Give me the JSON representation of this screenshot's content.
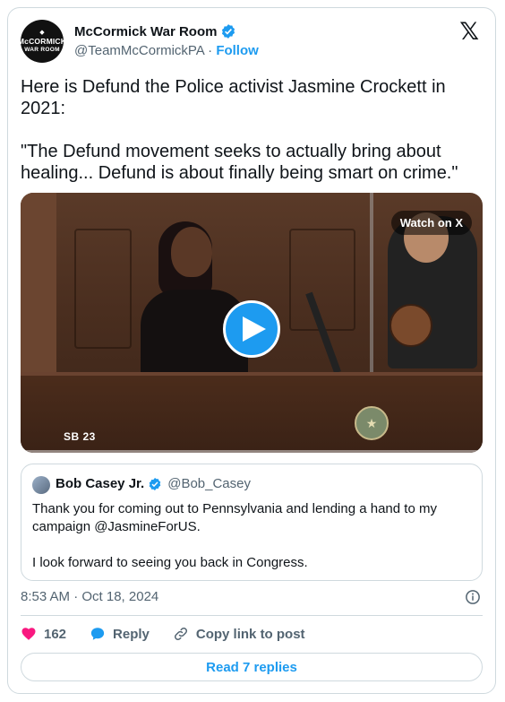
{
  "author": {
    "name": "McCormick War Room",
    "handle": "@TeamMcCormickPA",
    "separator": " · ",
    "follow_label": "Follow",
    "avatar_line1": "McCORMICK",
    "avatar_line2": "WAR ROOM",
    "verified_icon": "verified-badge-icon",
    "verified_color": "#1d9bf0"
  },
  "platform_icon": "x-logo-icon",
  "tweet": {
    "paragraph1": "Here is Defund the Police activist Jasmine Crockett in 2021:",
    "paragraph2": "\"The Defund movement seeks to actually bring about healing... Defund is about finally being smart on crime.\""
  },
  "media": {
    "watch_label": "Watch on X",
    "caption": "SB  23",
    "play_icon": "play-icon",
    "play_color": "#1d9bf0"
  },
  "quoted": {
    "name": "Bob Casey Jr.",
    "handle": "@Bob_Casey",
    "paragraph1": "Thank you for coming out to Pennsylvania and lending a hand to my campaign @JasmineForUS.",
    "paragraph2": "I look forward to seeing you back in Congress."
  },
  "meta": {
    "timestamp": "8:53 AM · Oct 18, 2024",
    "info_icon": "info-icon"
  },
  "actions": {
    "like_count": "162",
    "like_color": "#f91880",
    "reply_label": "Reply",
    "copy_label": "Copy link to post"
  },
  "read_replies_label": "Read 7 replies",
  "accent": "#1d9bf0"
}
